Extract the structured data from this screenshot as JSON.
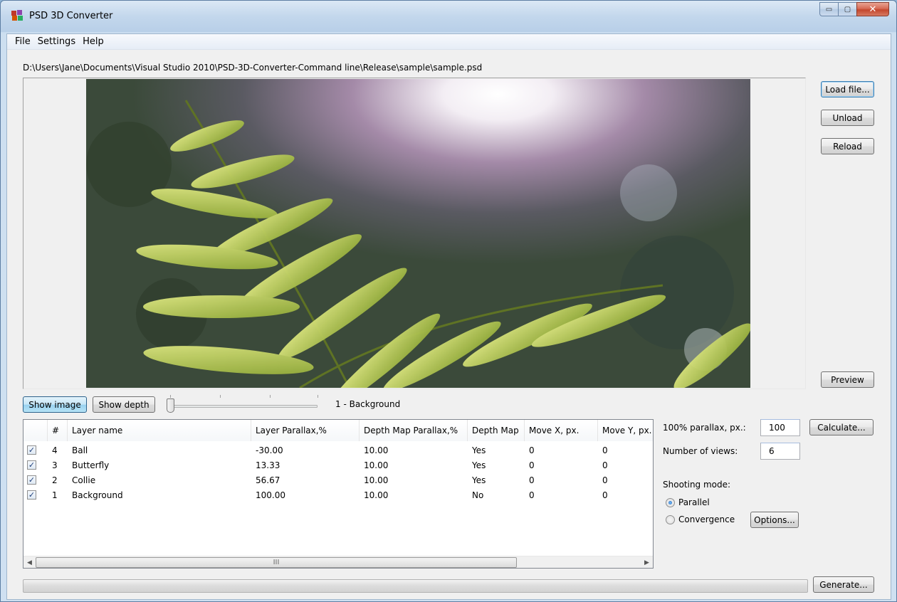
{
  "window": {
    "title": "PSD 3D Converter",
    "controls": {
      "minimize": "▭",
      "maximize": "▢",
      "close": "✕"
    }
  },
  "menu": {
    "file": "File",
    "settings": "Settings",
    "help": "Help"
  },
  "file_path": "D:\\Users\\Jane\\Documents\\Visual Studio 2010\\PSD-3D-Converter-Command line\\Release\\sample\\sample.psd",
  "side_buttons": {
    "load": "Load file...",
    "unload": "Unload",
    "reload": "Reload",
    "preview": "Preview"
  },
  "view_toggle": {
    "show_image": "Show image",
    "show_depth": "Show depth",
    "active": "show_image"
  },
  "layer_slider": {
    "position": 0,
    "current_label": "1 - Background"
  },
  "layers_table": {
    "columns": [
      "",
      "#",
      "Layer name",
      "Layer Parallax,%",
      "Depth Map Parallax,%",
      "Depth Map",
      "Move X, px.",
      "Move Y, px."
    ],
    "rows": [
      {
        "checked": true,
        "num": "4",
        "name": "Ball",
        "parallax": "-30.00",
        "depth_parallax": "10.00",
        "depth_map": "Yes",
        "move_x": "0",
        "move_y": "0"
      },
      {
        "checked": true,
        "num": "3",
        "name": "Butterfly",
        "parallax": "13.33",
        "depth_parallax": "10.00",
        "depth_map": "Yes",
        "move_x": "0",
        "move_y": "0"
      },
      {
        "checked": true,
        "num": "2",
        "name": "Collie",
        "parallax": "56.67",
        "depth_parallax": "10.00",
        "depth_map": "Yes",
        "move_x": "0",
        "move_y": "0"
      },
      {
        "checked": true,
        "num": "1",
        "name": "Background",
        "parallax": "100.00",
        "depth_parallax": "10.00",
        "depth_map": "No",
        "move_x": "0",
        "move_y": "0"
      }
    ],
    "scroll_grip": "III"
  },
  "settings": {
    "parallax_label": "100% parallax, px.:",
    "parallax_value": "100",
    "calculate": "Calculate...",
    "views_label": "Number of views:",
    "views_value": "6",
    "shooting_mode_label": "Shooting mode:",
    "mode_parallel": "Parallel",
    "mode_convergence": "Convergence",
    "selected_mode": "Parallel",
    "options": "Options..."
  },
  "progress": {
    "value": 0
  },
  "generate": "Generate..."
}
